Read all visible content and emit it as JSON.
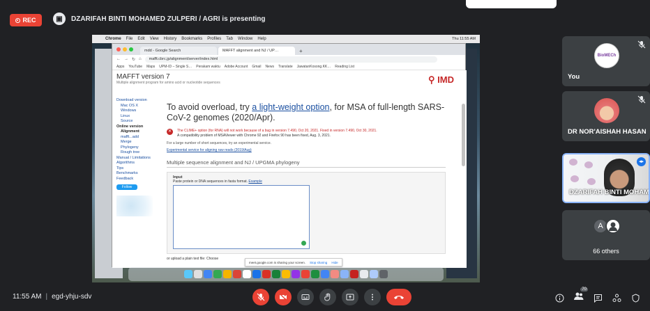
{
  "recording": {
    "label": "REC"
  },
  "presenter": {
    "text": "DZARIFAH BINTI MOHAMED ZULPERI / AGRI is presenting"
  },
  "mac_menu": {
    "items": [
      "Chrome",
      "File",
      "Edit",
      "View",
      "History",
      "Bookmarks",
      "Profiles",
      "Tab",
      "Window",
      "Help"
    ],
    "clock": "Thu 11:55 AM"
  },
  "browser": {
    "tabs": [
      "mdd - Google Search",
      "MAFFT alignment and NJ / UP…"
    ],
    "new_tab": "+",
    "url": "mafft.cbrc.jp/alignment/server/index.html",
    "bookmarks": [
      "Apps",
      "YouTube",
      "Maps",
      "UPM-ID – Single S…",
      "Perakam waktu",
      "Adobe Account",
      "Gmail",
      "News",
      "Translate",
      "JawatanKosong.KK…",
      "Reading List"
    ]
  },
  "mafft_page": {
    "title": "MAFFT version 7",
    "subtitle": "Multiple alignment program for amino acid or nucleotide sequences",
    "logo": "IMD",
    "sidebar": [
      "Download version",
      "Mac OS X",
      "Windows",
      "Linux",
      "Source",
      "Online version",
      "Alignment",
      "mafft...add",
      "Merge",
      "Phylogeny",
      "Rough tree",
      "Manual / Limitations",
      "Algorithms",
      "Tips",
      "Benchmarks",
      "Feedback"
    ],
    "follow_label": "Follow",
    "headline_before": "To avoid overload, try ",
    "headline_link": "a light-weight option",
    "headline_after": ", for MSA of full-length SARS-CoV-2 genomes (2020/Apr).",
    "notice_red": "The CLIME+ option (for RNA) will not work because of a bug in version 7.490, Oct 20, 2021. Fixed in version 7.490, Oct 30, 2021.",
    "notice_black": "A compatibility problem of MSAViewer with Chrome 92 and Firefox 90 has been fixed, Aug. 3, 2021.",
    "note1": "For a large number of short sequences, try an experimental service.",
    "note2": "Experimental service for aligning raw reads (2019/Aug)",
    "section_title": "Multiple sequence alignment and NJ / UPGMA phylogeny",
    "input_label": "Input",
    "input_hint": "Paste protein or DNA sequences in fasta format.",
    "example_link": "Example",
    "upload_text": "or upload a plain text file: Choose",
    "share_text": "meet.google.com is sharing your screen.",
    "share_stop": "Stop sharing",
    "share_hide": "Hide"
  },
  "participants": [
    {
      "name": "You",
      "avatar_text": "BioMECh",
      "muted": true
    },
    {
      "name": "DR NOR'AISHAH HASAN",
      "muted": true
    },
    {
      "name": "DZARIFAH BINTI MOHAMED",
      "active": true
    },
    {
      "name": "66 others",
      "avatar_letter": "A"
    }
  ],
  "meeting": {
    "time": "11:55 AM",
    "code": "egd-yhju-sdv",
    "people_count": "70"
  },
  "colors": {
    "accent": "#ea4335",
    "tile": "#3c4043",
    "bg": "#202124",
    "active_border": "#8ab4f8"
  }
}
